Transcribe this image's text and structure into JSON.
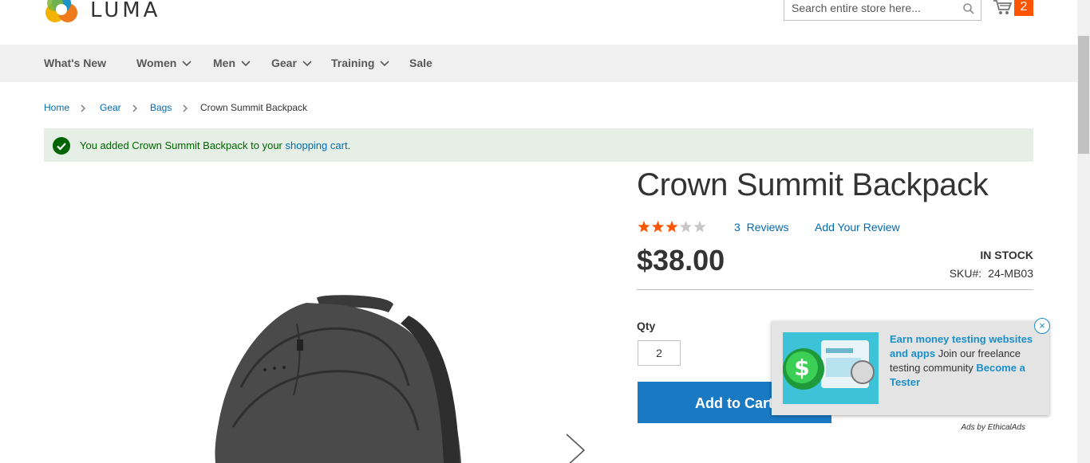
{
  "brand": {
    "name": "LUMA"
  },
  "search": {
    "placeholder": "Search entire store here..."
  },
  "cart": {
    "count": "2"
  },
  "nav": {
    "items": [
      {
        "label": "What's New",
        "has_menu": false
      },
      {
        "label": "Women",
        "has_menu": true
      },
      {
        "label": "Men",
        "has_menu": true
      },
      {
        "label": "Gear",
        "has_menu": true
      },
      {
        "label": "Training",
        "has_menu": true
      },
      {
        "label": "Sale",
        "has_menu": false
      }
    ]
  },
  "breadcrumb": [
    "Home",
    "Gear",
    "Bags",
    "Crown Summit Backpack"
  ],
  "message": {
    "prefix": "You added Crown Summit Backpack to your ",
    "link": "shopping cart",
    "suffix": "."
  },
  "product": {
    "title": "Crown Summit Backpack",
    "rating_fraction": 0.6,
    "reviews_count": "3",
    "reviews_label": "Reviews",
    "add_review": "Add Your Review",
    "price": "$38.00",
    "stock": "IN STOCK",
    "sku_label": "SKU#:",
    "sku": "24-MB03",
    "qty_label": "Qty",
    "qty": "2",
    "add_to_cart": "Add to Cart"
  },
  "ad": {
    "headline": "Earn money testing websites and apps",
    "body": " Join our freelance testing community ",
    "cta": "Become a Tester",
    "close": "×",
    "credit": "Ads by EthicalAds"
  },
  "colors": {
    "accent": "#1979c3",
    "link": "#006bb4",
    "star": "#ff5501",
    "success_bg": "#e5efe5",
    "success_text": "#006400"
  }
}
